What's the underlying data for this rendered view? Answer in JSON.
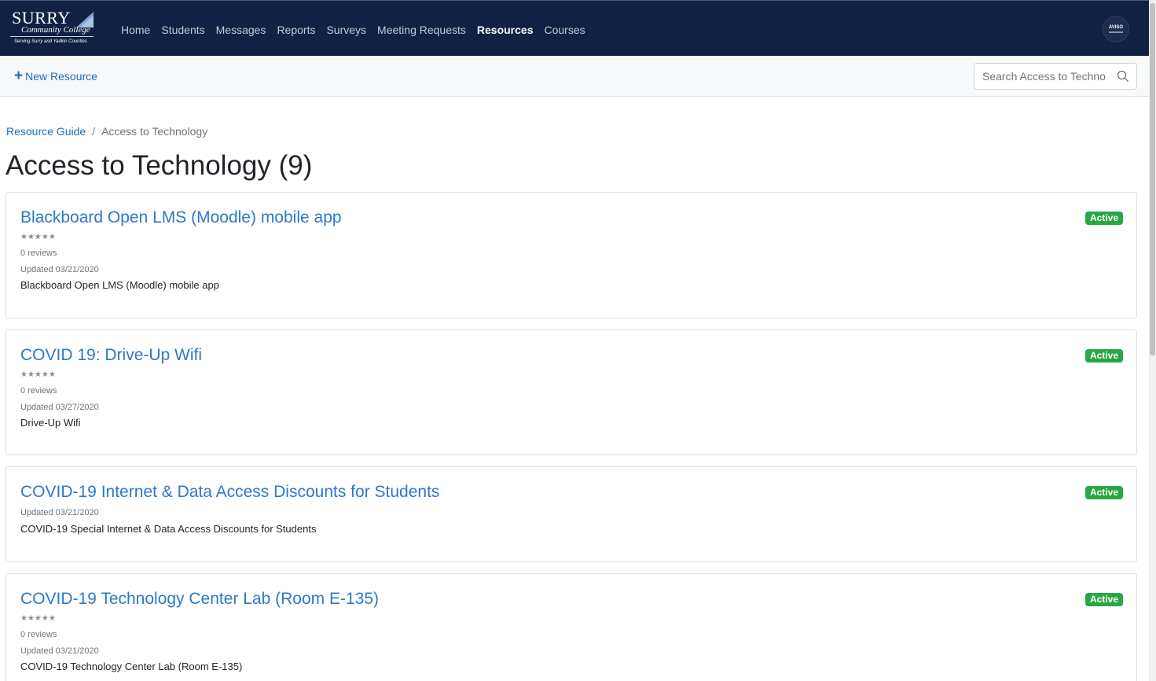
{
  "logo": {
    "name": "SURRY",
    "subtitle": "Community College",
    "tagline": "Serving Surry and Yadkin Counties"
  },
  "nav": {
    "items": [
      {
        "label": "Home",
        "active": false
      },
      {
        "label": "Students",
        "active": false
      },
      {
        "label": "Messages",
        "active": false
      },
      {
        "label": "Reports",
        "active": false
      },
      {
        "label": "Surveys",
        "active": false
      },
      {
        "label": "Meeting Requests",
        "active": false
      },
      {
        "label": "Resources",
        "active": true
      },
      {
        "label": "Courses",
        "active": false
      }
    ],
    "avatar_text": "AVISO"
  },
  "toolbar": {
    "new_resource_label": "New Resource",
    "search_placeholder": "Search Access to Techno"
  },
  "breadcrumb": {
    "parent": "Resource Guide",
    "separator": "/",
    "current": "Access to Technology"
  },
  "page_title": "Access to Technology (9)",
  "resources": [
    {
      "title": "Blackboard Open LMS (Moodle) mobile app",
      "status": "Active",
      "rating": "★★★★★",
      "reviews": "0 reviews",
      "updated": "Updated 03/21/2020",
      "description": "Blackboard Open LMS (Moodle) mobile app"
    },
    {
      "title": "COVID 19: Drive-Up Wifi",
      "status": "Active",
      "rating": "★★★★★",
      "reviews": "0 reviews",
      "updated": "Updated 03/27/2020",
      "description": "Drive-Up Wifi"
    },
    {
      "title": "COVID-19 Internet & Data Access Discounts for Students",
      "status": "Active",
      "updated": "Updated 03/21/2020",
      "description": "COVID-19 Special Internet & Data Access Discounts for Students"
    },
    {
      "title": "COVID-19 Technology Center Lab (Room E-135)",
      "status": "Active",
      "rating": "★★★★★",
      "reviews": "0 reviews",
      "updated": "Updated 03/21/2020",
      "description": "COVID-19 Technology Center Lab (Room E-135)"
    }
  ],
  "colors": {
    "navbar": "#0f2244",
    "link": "#1a6ec2",
    "badge": "#28a745"
  }
}
